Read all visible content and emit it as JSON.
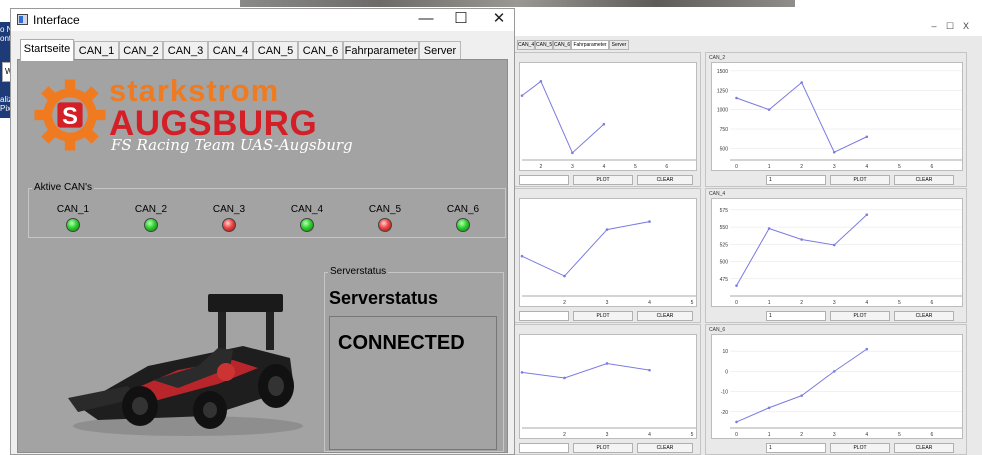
{
  "background_fragment": {
    "text_lines": [
      "o N",
      "ontr"
    ],
    "input_text": "W",
    "lower_lines": [
      "aliz",
      "Pix"
    ]
  },
  "window": {
    "title": "Interface",
    "minimize": "—",
    "maximize": "☐",
    "close": "✕"
  },
  "tabs": [
    "Startseite",
    "CAN_1",
    "CAN_2",
    "CAN_3",
    "CAN_4",
    "CAN_5",
    "CAN_6",
    "Fahrparameter",
    "Server"
  ],
  "active_tab": "Startseite",
  "logo": {
    "line1": "starkstrom",
    "line2": "AUGSBURG",
    "line3": "FS Racing Team UAS-Augsburg",
    "gear_letter": "S"
  },
  "can_group": {
    "title": "Aktive CAN's",
    "items": [
      {
        "label": "CAN_1",
        "status": "active"
      },
      {
        "label": "CAN_2",
        "status": "active"
      },
      {
        "label": "CAN_3",
        "status": "inactive"
      },
      {
        "label": "CAN_4",
        "status": "active"
      },
      {
        "label": "CAN_5",
        "status": "inactive"
      },
      {
        "label": "CAN_6",
        "status": "active"
      }
    ]
  },
  "server_group": {
    "title": "Serverstatus",
    "heading": "Serverstatus",
    "status": "CONNECTED"
  },
  "colors": {
    "logo_orange": "#f07a1f",
    "logo_red": "#d41f26",
    "led_green": "#2fd12f",
    "led_red": "#ef4444",
    "panel_gray": "#a3a3a3",
    "plot_line": "#7b7be0"
  },
  "secondary_window": {
    "controls": [
      "–",
      "☐",
      "X"
    ],
    "tabs": [
      "CAN_4",
      "CAN_5",
      "CAN_6",
      "Fahrparameter",
      "Server"
    ],
    "active_tab": "Fahrparameter",
    "plots": [
      {
        "title": "",
        "xticks": [
          "2",
          "3",
          "4",
          "5",
          "6"
        ],
        "yticks": [],
        "points": [
          [
            1.4,
            7
          ],
          [
            2,
            8
          ],
          [
            3,
            3
          ],
          [
            4,
            5
          ]
        ],
        "xlim": [
          1.4,
          6.8
        ],
        "ylim": [
          2.5,
          9
        ],
        "spin_value": "",
        "plot_label": "PLOT",
        "clear_label": "CLEAR"
      },
      {
        "title": "CAN_2",
        "xticks": [
          "0",
          "1",
          "2",
          "3",
          "4",
          "5",
          "6"
        ],
        "yticks": [
          "1500",
          "1250",
          "1000",
          "750",
          "500"
        ],
        "points": [
          [
            0,
            1150
          ],
          [
            1,
            1000
          ],
          [
            2,
            1350
          ],
          [
            3,
            450
          ],
          [
            4,
            650
          ]
        ],
        "xlim": [
          -0.2,
          6.8
        ],
        "ylim": [
          350,
          1550
        ],
        "spin_value": "1",
        "plot_label": "PLOT",
        "clear_label": "CLEAR"
      },
      {
        "title": "",
        "xticks": [
          "2",
          "3",
          "4",
          "5"
        ],
        "yticks": [],
        "points": [
          [
            1,
            5
          ],
          [
            2,
            3.5
          ],
          [
            3,
            7
          ],
          [
            4,
            7.6
          ]
        ],
        "xlim": [
          1,
          5
        ],
        "ylim": [
          2,
          9
        ],
        "spin_value": "",
        "plot_label": "PLOT",
        "clear_label": "CLEAR"
      },
      {
        "title": "CAN_4",
        "xticks": [
          "0",
          "1",
          "2",
          "3",
          "4",
          "5",
          "6"
        ],
        "yticks": [
          "575",
          "550",
          "525",
          "500",
          "475"
        ],
        "points": [
          [
            0,
            465
          ],
          [
            1,
            548
          ],
          [
            2,
            532
          ],
          [
            3,
            524
          ],
          [
            4,
            568
          ]
        ],
        "xlim": [
          -0.2,
          6.8
        ],
        "ylim": [
          450,
          585
        ],
        "spin_value": "1",
        "plot_label": "PLOT",
        "clear_label": "CLEAR"
      },
      {
        "title": "",
        "xticks": [
          "2",
          "3",
          "4",
          "5"
        ],
        "yticks": [],
        "points": [
          [
            1,
            6
          ],
          [
            2,
            5.5
          ],
          [
            3,
            6.8
          ],
          [
            4,
            6.2
          ]
        ],
        "xlim": [
          1,
          5
        ],
        "ylim": [
          1,
          9
        ],
        "spin_value": "",
        "plot_label": "PLOT",
        "clear_label": "CLEAR"
      },
      {
        "title": "CAN_6",
        "xticks": [
          "0",
          "1",
          "2",
          "3",
          "4",
          "5",
          "6"
        ],
        "yticks": [
          "10",
          "0",
          "-10",
          "-20"
        ],
        "points": [
          [
            0,
            -25
          ],
          [
            1,
            -18
          ],
          [
            2,
            -12
          ],
          [
            3,
            0
          ],
          [
            4,
            11
          ]
        ],
        "xlim": [
          -0.2,
          6.8
        ],
        "ylim": [
          -28,
          16
        ],
        "spin_value": "1",
        "plot_label": "PLOT",
        "clear_label": "CLEAR"
      }
    ]
  }
}
